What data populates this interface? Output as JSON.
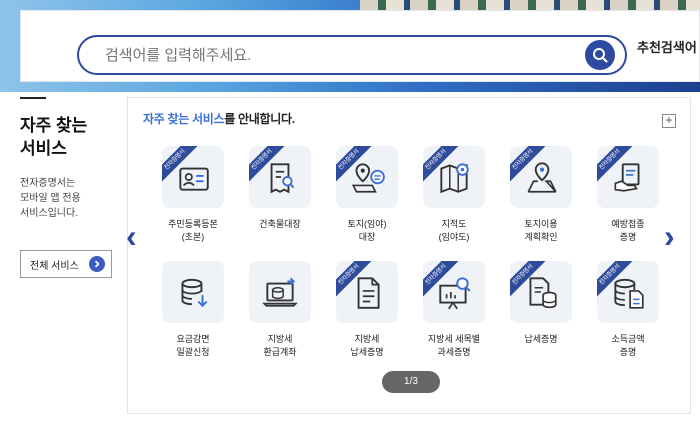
{
  "search": {
    "placeholder": "검색어를 입력해주세요.",
    "recommend_label": "추천검색어"
  },
  "left": {
    "title": "자주 찾는\n서비스",
    "description": "전자증명서는\n모바일 앱 전용\n서비스입니다.",
    "all_button": "전체 서비스"
  },
  "panel": {
    "title_highlight": "자주 찾는 서비스",
    "title_rest": "를 안내합니다.",
    "plus_label": "+",
    "ribbon_text": "전자증명서",
    "pager": "1/3",
    "prev_arrow": "‹",
    "next_arrow": "›"
  },
  "services": [
    {
      "label": "주민등록등본\n(초본)",
      "icon": "id-card-icon",
      "ribbon": true
    },
    {
      "label": "건축물대장",
      "icon": "document-search-icon",
      "ribbon": true
    },
    {
      "label": "토지(임야)\n대장",
      "icon": "map-pin-chat-icon",
      "ribbon": true
    },
    {
      "label": "지적도\n(임야도)",
      "icon": "folded-map-icon",
      "ribbon": true
    },
    {
      "label": "토지이용\n계획확인",
      "icon": "location-map-icon",
      "ribbon": true
    },
    {
      "label": "예방접종\n증명",
      "icon": "hand-document-icon",
      "ribbon": true
    },
    {
      "label": "요금감면\n일괄신청",
      "icon": "database-download-icon",
      "ribbon": false
    },
    {
      "label": "지방세\n환급계좌",
      "icon": "laptop-database-icon",
      "ribbon": false
    },
    {
      "label": "지방세\n납세증명",
      "icon": "document-lines-icon",
      "ribbon": true
    },
    {
      "label": "지방세 세목별\n과세증명",
      "icon": "presentation-search-icon",
      "ribbon": true
    },
    {
      "label": "납세증명",
      "icon": "document-database-icon",
      "ribbon": true
    },
    {
      "label": "소득금액\n증명",
      "icon": "database-document-icon",
      "ribbon": true
    }
  ],
  "colors": {
    "brand_blue": "#2c4aa0",
    "highlight_blue": "#3a6fd8",
    "icon_bg": "#eff3f8",
    "ribbon": "#2e4b9c"
  }
}
